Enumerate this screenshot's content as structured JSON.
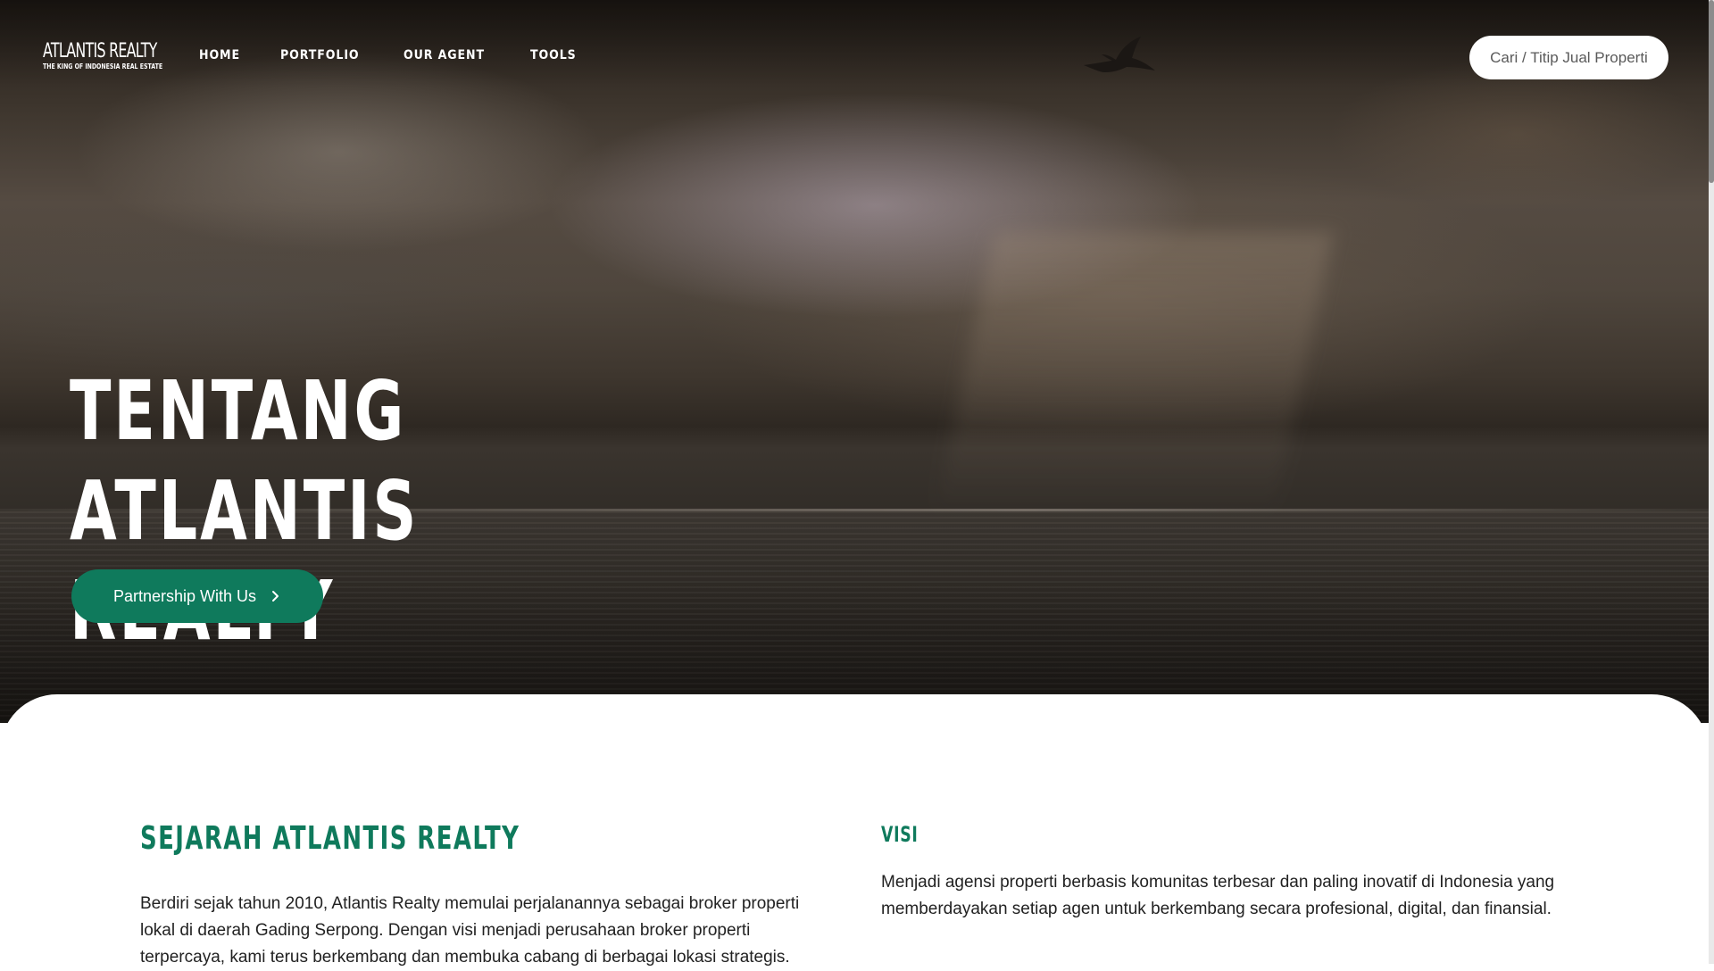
{
  "brand": {
    "name": "ATLANTIS REALTY",
    "tagline": "THE KING OF INDONESIA REAL ESTATE"
  },
  "nav": {
    "items": [
      {
        "label": "HOME"
      },
      {
        "label": "PORTFOLIO"
      },
      {
        "label": "OUR AGENT"
      },
      {
        "label": "TOOLS"
      }
    ],
    "cta_label": "Cari / Titip Jual Properti"
  },
  "hero": {
    "title": "TENTANG ATLANTIS REALTY",
    "button_label": "Partnership With Us",
    "button_icon": "chevron-right-icon",
    "decoration_icon": "bird-icon"
  },
  "sejarah": {
    "title": "SEJARAH ATLANTIS REALTY",
    "text": "Berdiri sejak tahun 2010, Atlantis Realty memulai perjalanannya sebagai broker properti lokal di daerah Gading Serpong. Dengan visi menjadi perusahaan broker properti terpercaya, kami terus berkembang dan membuka cabang di berbagai lokasi strategis."
  },
  "visi": {
    "title": "VISI",
    "text": "Menjadi agensi properti berbasis komunitas terbesar dan paling inovatif di Indonesia yang memberdayakan setiap agen untuk berkembang secara profesional, digital, dan finansial."
  },
  "colors": {
    "brand_green": "#0f7a5c",
    "text_dark": "#222222",
    "white": "#ffffff"
  }
}
